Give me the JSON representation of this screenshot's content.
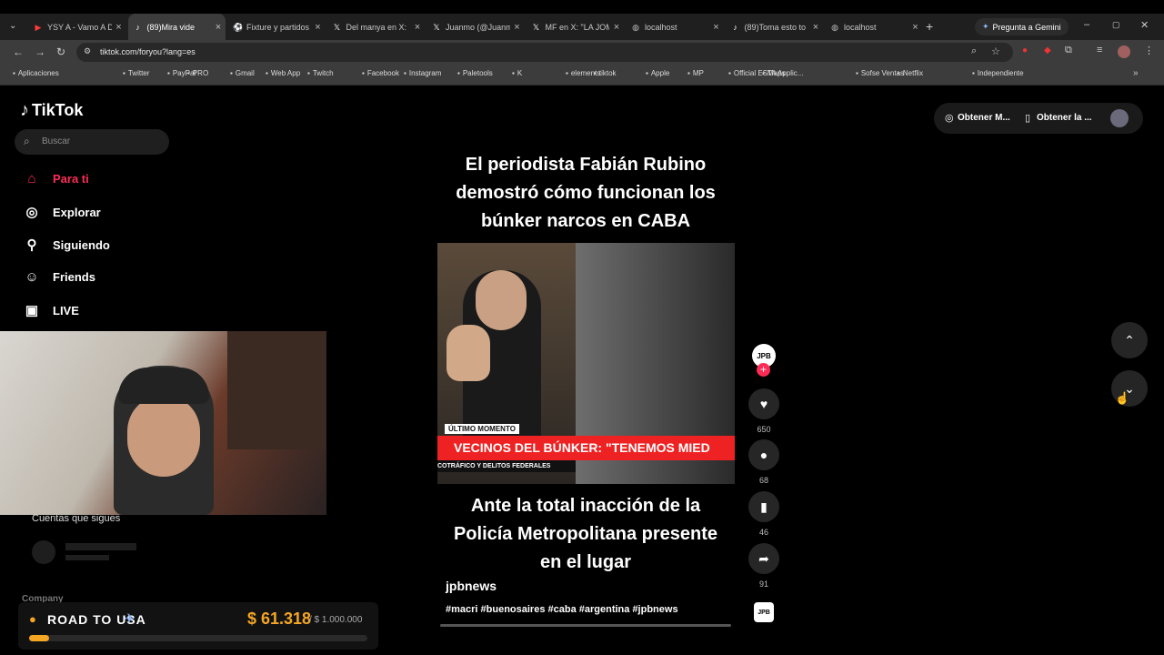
{
  "browser": {
    "tabs": [
      {
        "title": "YSY A - Vamo A D",
        "icon": "youtube-icon",
        "active": false
      },
      {
        "title": "(89)Mira vide",
        "icon": "tiktok-icon",
        "active": true
      },
      {
        "title": "Fixture y partidos",
        "icon": "ball-icon",
        "active": false
      },
      {
        "title": "Del manya en X:",
        "icon": "x-icon",
        "active": false
      },
      {
        "title": "Juanmo (@Juanm",
        "icon": "x-icon",
        "active": false
      },
      {
        "title": "MF en X: \"LA JOM",
        "icon": "x-icon",
        "active": false
      },
      {
        "title": "localhost",
        "icon": "globe-icon",
        "active": false
      },
      {
        "title": "(89)Toma esto to",
        "icon": "tiktok-icon",
        "active": false
      },
      {
        "title": "localhost",
        "icon": "globe-icon",
        "active": false
      }
    ],
    "gemini_button": "Pregunta a Gemini",
    "url": "tiktok.com/foryou?lang=es",
    "bookmarks": [
      "Aplicaciones",
      "Twitter",
      "PayPal",
      "PRO",
      "Gmail",
      "Web App",
      "Twitch",
      "Facebook",
      "Instagram",
      "Paletools",
      "K",
      "elements",
      "tiktok",
      "Apple",
      "MP",
      "Official ESTA Applic...",
      "Maps",
      "Sofse Ventas",
      "Netflix",
      "Independiente"
    ]
  },
  "tiktok": {
    "logo": "TikTok",
    "search_placeholder": "Buscar",
    "nav": [
      {
        "label": "Para ti",
        "icon": "home-icon",
        "active": true
      },
      {
        "label": "Explorar",
        "icon": "compass-icon",
        "active": false
      },
      {
        "label": "Siguiendo",
        "icon": "user-plus-icon",
        "active": false
      },
      {
        "label": "Friends",
        "icon": "users-icon",
        "active": false
      },
      {
        "label": "LIVE",
        "icon": "live-icon",
        "active": false
      }
    ],
    "following_heading": "Cuentas que sigues",
    "company_label": "Company",
    "header_buttons": [
      "Obtener M...",
      "Obtener la ..."
    ],
    "post": {
      "top_caption": "El periodista Fabián Rubino demostró cómo funcionan los búnker narcos en CABA",
      "video_badge": "ÚLTIMO MOMENTO",
      "video_banner": "VECINOS DEL BÚNKER: \"TENEMOS MIED",
      "video_subbanner": "COTRÁFICO Y DELITOS FEDERALES",
      "bottom_caption": "Ante la total inacción de la Policía Metropolitana presente en el lugar",
      "author": "jpbnews",
      "hashtags": "#macri #buenosaires #caba #argentina #jpbnews",
      "likes": "650",
      "comments": "68",
      "saves": "46",
      "shares": "91",
      "avatar_text": "JPB"
    }
  },
  "overlay": {
    "goal_label": "ROAD TO USA",
    "current": "$ 61.318",
    "target": "/ $ 1.000.000",
    "progress": 0.06
  },
  "colors": {
    "accent": "#fe2c55",
    "goal_amount": "#f5a623"
  }
}
